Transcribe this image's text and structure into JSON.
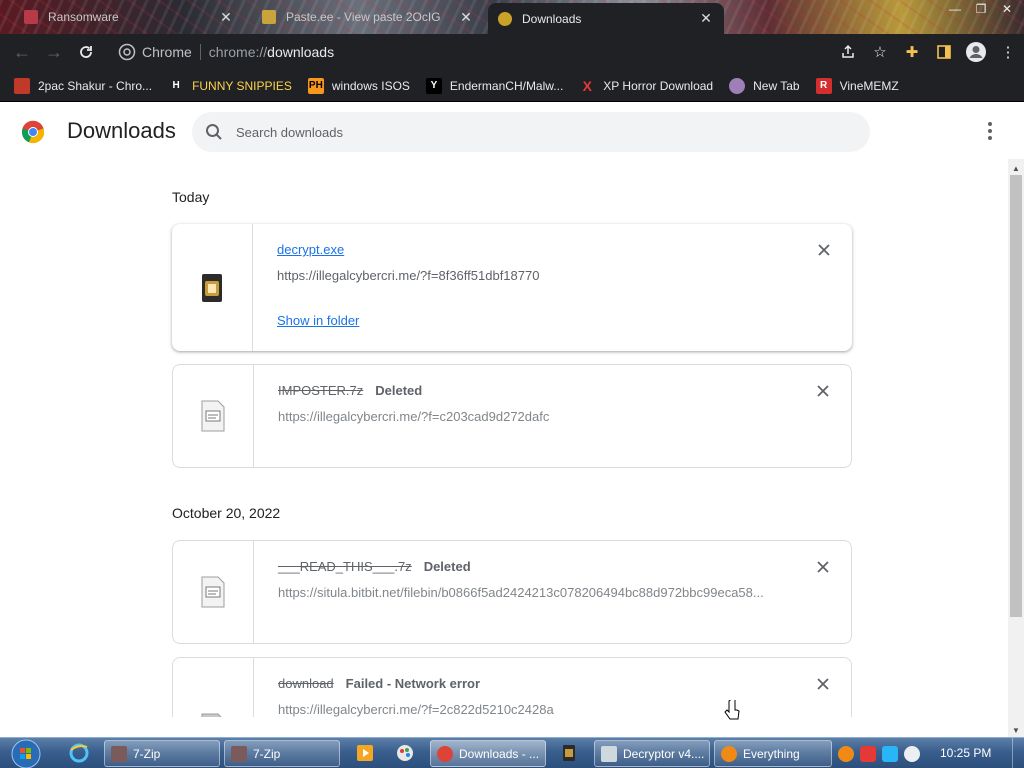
{
  "browser": {
    "tabs": [
      {
        "title": "Ransomware"
      },
      {
        "title": "Paste.ee - View paste 2OcIG"
      },
      {
        "title": "Downloads",
        "active": true
      }
    ],
    "omnibox": {
      "scheme_label": "Chrome",
      "url_prefix": "chrome://",
      "url_host": "downloads"
    },
    "bookmarks": [
      {
        "label": "2pac Shakur - Chro...",
        "icon": "video-favicon",
        "color": "#c0392b"
      },
      {
        "label": "FUNNY SNIPPIES",
        "icon": "H-favicon",
        "glyph": "H",
        "color": "#ffffff"
      },
      {
        "label": "windows ISOS",
        "icon": "PH-favicon",
        "glyph": "PH",
        "color": "#f7971d"
      },
      {
        "label": "EndermanCH/Malw...",
        "icon": "Y-favicon",
        "glyph": "Y",
        "color": "#ffffff"
      },
      {
        "label": "XP Horror Download",
        "icon": "X-favicon",
        "glyph": "X",
        "color": "#e53935"
      },
      {
        "label": "New Tab",
        "icon": "globe-favicon",
        "color": "#9e7fb8"
      },
      {
        "label": "VineMEMZ",
        "icon": "R-favicon",
        "glyph": "R",
        "color": "#d32f2f"
      }
    ]
  },
  "page": {
    "title": "Downloads",
    "search_placeholder": "Search downloads"
  },
  "groups": [
    {
      "date": "Today",
      "items": [
        {
          "file_name": "decrypt.exe",
          "url": "https://illegalcybercri.me/?f=8f36ff51dbf18770",
          "action": "Show in folder",
          "status": ""
        },
        {
          "file_name": "IMPOSTER.7z",
          "url": "https://illegalcybercri.me/?f=c203cad9d272dafc",
          "status": "Deleted"
        }
      ]
    },
    {
      "date": "October 20, 2022",
      "items": [
        {
          "file_name": "___READ_THIS___.7z",
          "url": "https://situla.bitbit.net/filebin/b0866f5ad2424213c078206494bc88d972bbc99eca58...",
          "status": "Deleted"
        },
        {
          "file_name": "download",
          "url": "https://illegalcybercri.me/?f=2c822d5210c2428a",
          "status": "Failed - Network error"
        }
      ]
    }
  ],
  "taskbar": {
    "tasks": [
      {
        "label": "7-Zip",
        "icon": "7zip-icon"
      },
      {
        "label": "7-Zip",
        "icon": "7zip-icon"
      },
      {
        "label": "Downloads - ...",
        "icon": "chrome-icon",
        "active": true
      },
      {
        "label": "Decryptor v4....",
        "icon": "window-icon"
      },
      {
        "label": "Everything",
        "icon": "everything-icon"
      }
    ],
    "clock": "10:25 PM"
  }
}
